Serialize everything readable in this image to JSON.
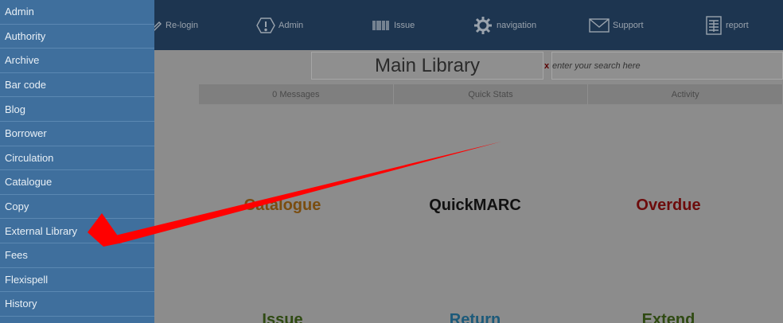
{
  "topnav": {
    "relogin": "Re-login",
    "admin": "Admin",
    "issue": "Issue",
    "navigation": "navigation",
    "support": "Support",
    "report": "report"
  },
  "header": {
    "library_name": "Main Library",
    "search_clear": "x",
    "search_placeholder": "enter your search here"
  },
  "tabs": [
    "0 Messages",
    "Quick Stats",
    "Activity"
  ],
  "tiles": [
    {
      "label": "Catalogue",
      "color": "#7a4d10"
    },
    {
      "label": "QuickMARC",
      "color": "#111111"
    },
    {
      "label": "Overdue",
      "color": "#6d0c0c"
    },
    {
      "label": "Issue",
      "color": "#2f4a12"
    },
    {
      "label": "Return",
      "color": "#1c5a7a"
    },
    {
      "label": "Extend",
      "color": "#2f4a12"
    }
  ],
  "sidebar": {
    "items": [
      "Admin",
      "Authority",
      "Archive",
      "Bar code",
      "Blog",
      "Borrower",
      "Circulation",
      "Catalogue",
      "Copy",
      "External Library",
      "Fees",
      "Flexispell",
      "History"
    ]
  },
  "colors": {
    "sidebar": "#3f6f9d",
    "topbar": "#1d3550",
    "overlay": "#8c8c8c",
    "annotation_arrow": "#ff0000"
  }
}
